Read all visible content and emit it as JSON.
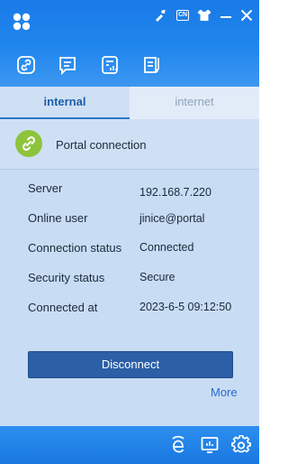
{
  "window": {
    "controls": {
      "skin_icon": "skin-icon",
      "language_badge": "CN",
      "shirt_icon": "shirt-icon",
      "minimize_icon": "minimize-icon",
      "close_icon": "close-icon"
    }
  },
  "toolbar": {
    "items": [
      {
        "icon": "connection-icon",
        "active": true
      },
      {
        "icon": "message-icon",
        "active": false
      },
      {
        "icon": "statistics-icon",
        "active": false
      },
      {
        "icon": "notes-icon",
        "active": false
      }
    ]
  },
  "tabs": [
    {
      "label": "internal",
      "active": true
    },
    {
      "label": "internet",
      "active": false
    }
  ],
  "portal": {
    "title": "Portal connection",
    "icon": "link-icon"
  },
  "info": [
    {
      "label": "Server",
      "value": "192.168.7.220"
    },
    {
      "label": "Online user",
      "value": "jinice@portal"
    },
    {
      "label": "Connection status",
      "value": "Connected"
    },
    {
      "label": "Security status",
      "value": "Secure"
    },
    {
      "label": "Connected at",
      "value": "2023-6-5 09:12:50"
    }
  ],
  "actions": {
    "disconnect_label": "Disconnect",
    "more_label": "More"
  },
  "footer": {
    "icons": [
      "browser-icon",
      "monitor-icon",
      "settings-icon"
    ]
  },
  "colors": {
    "header_blue": "#1f86ee",
    "panel_bg": "#c8dcf3",
    "button_blue": "#2b5fa6",
    "portal_green": "#8dc43c",
    "link_blue": "#2a6ccf"
  }
}
